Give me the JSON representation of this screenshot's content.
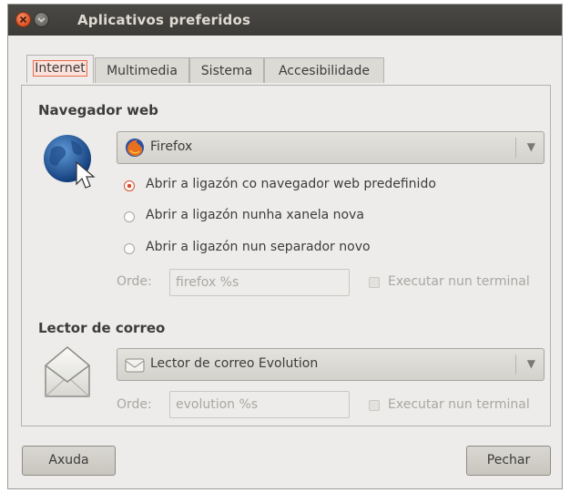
{
  "window": {
    "title": "Aplicativos preferidos"
  },
  "tabs": [
    {
      "label": "Internet"
    },
    {
      "label": "Multimedia"
    },
    {
      "label": "Sistema"
    },
    {
      "label": "Accesibilidade"
    }
  ],
  "browser": {
    "section_title": "Navegador web",
    "selected": "Firefox",
    "icon": "globe-icon",
    "options": [
      {
        "label": "Abrir a ligazón co navegador web predefinido",
        "checked": true
      },
      {
        "label": "Abrir a ligazón nunha xanela nova",
        "checked": false
      },
      {
        "label": "Abrir a ligazón nun separador novo",
        "checked": false
      }
    ],
    "command_label": "Orde:",
    "command_value": "firefox %s",
    "terminal_label": "Executar nun terminal"
  },
  "mail": {
    "section_title": "Lector de correo",
    "selected": "Lector de correo Evolution",
    "icon": "envelope-icon",
    "command_label": "Orde:",
    "command_value": "evolution %s",
    "terminal_label": "Executar nun terminal"
  },
  "buttons": {
    "help": "Axuda",
    "close": "Pechar"
  },
  "colors": {
    "accent": "#e05a2c",
    "titlebar": "#3c3b37",
    "window_bg": "#edeceb"
  }
}
